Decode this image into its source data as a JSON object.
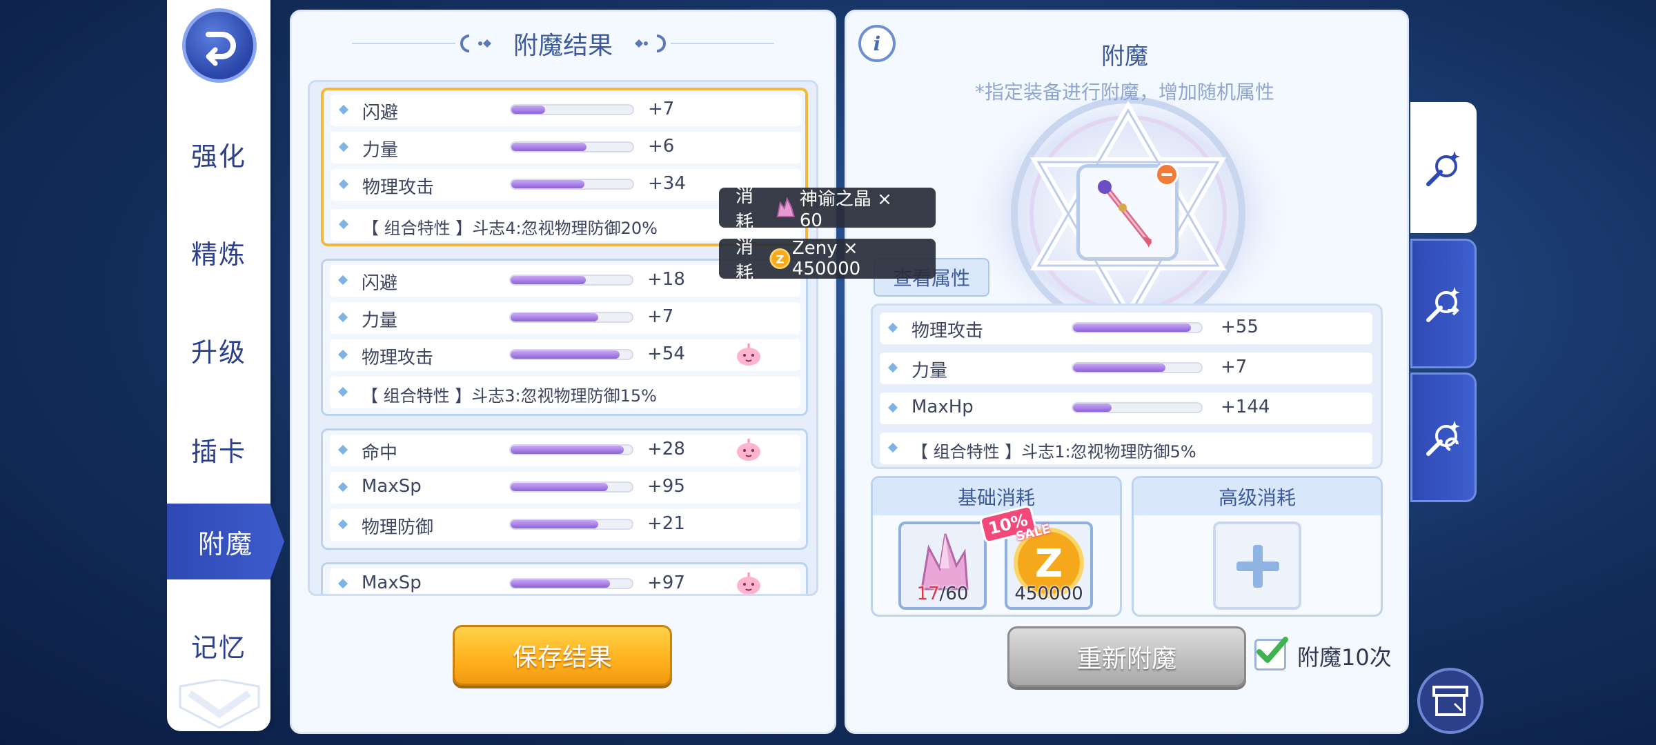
{
  "nav": {
    "items": [
      {
        "label": "强化"
      },
      {
        "label": "精炼"
      },
      {
        "label": "升级"
      },
      {
        "label": "插卡"
      },
      {
        "label": "附魔"
      },
      {
        "label": "记忆"
      }
    ],
    "active": "附魔"
  },
  "result_panel": {
    "title": "附魔结果",
    "groups": [
      {
        "selected": true,
        "attributes": [
          {
            "name": "闪避",
            "value": "+7",
            "fill": 0.28,
            "badge": false
          },
          {
            "name": "力量",
            "value": "+6",
            "fill": 0.62,
            "badge": false
          },
          {
            "name": "物理攻击",
            "value": "+34",
            "fill": 0.6,
            "badge": false
          }
        ],
        "combo": "【 组合特性 】斗志4:忽视物理防御20%"
      },
      {
        "selected": false,
        "attributes": [
          {
            "name": "闪避",
            "value": "+18",
            "fill": 0.62,
            "badge": false
          },
          {
            "name": "力量",
            "value": "+7",
            "fill": 0.72,
            "badge": false
          },
          {
            "name": "物理攻击",
            "value": "+54",
            "fill": 0.9,
            "badge": true
          }
        ],
        "combo": "【 组合特性 】斗志3:忽视物理防御15%"
      },
      {
        "selected": false,
        "attributes": [
          {
            "name": "命中",
            "value": "+28",
            "fill": 0.93,
            "badge": true
          },
          {
            "name": "MaxSp",
            "value": "+95",
            "fill": 0.8,
            "badge": false
          },
          {
            "name": "物理防御",
            "value": "+21",
            "fill": 0.72,
            "badge": false
          }
        ],
        "combo": ""
      },
      {
        "selected": false,
        "attributes": [
          {
            "name": "MaxSp",
            "value": "+97",
            "fill": 0.82,
            "badge": true
          }
        ],
        "combo": ""
      }
    ],
    "save_button": "保存结果"
  },
  "tooltips": {
    "cost1": {
      "prefix": "消耗",
      "text": "神谕之晶 × 60"
    },
    "cost2": {
      "prefix": "消耗",
      "text": "Zeny × 450000"
    }
  },
  "enchant_panel": {
    "title": "附魔",
    "subtitle": "*指定装备进行附魔，增加随机属性",
    "view_attributes": "查看属性",
    "attributes": [
      {
        "name": "物理攻击",
        "value": "+55",
        "fill": 0.92
      },
      {
        "name": "力量",
        "value": "+7",
        "fill": 0.72
      },
      {
        "name": "MaxHp",
        "value": "+144",
        "fill": 0.3
      }
    ],
    "combo": "【 组合特性 】斗志1:忽视物理防御5%",
    "basic_cost": {
      "title": "基础消耗",
      "crystal_owned": "17",
      "crystal_need": "/60",
      "zeny": "450000",
      "sale_percent": "10%",
      "sale_label": "SALE"
    },
    "advanced_cost": {
      "title": "高级消耗"
    },
    "reenchant_button": "重新附魔",
    "repeat_checked": true,
    "repeat_label": "附魔10次"
  },
  "colors": {
    "accent_blue": "#2e49b4",
    "bar_purple": "#8e62d9",
    "save_orange": "#ffb320",
    "selected_border": "#f1b83a"
  }
}
